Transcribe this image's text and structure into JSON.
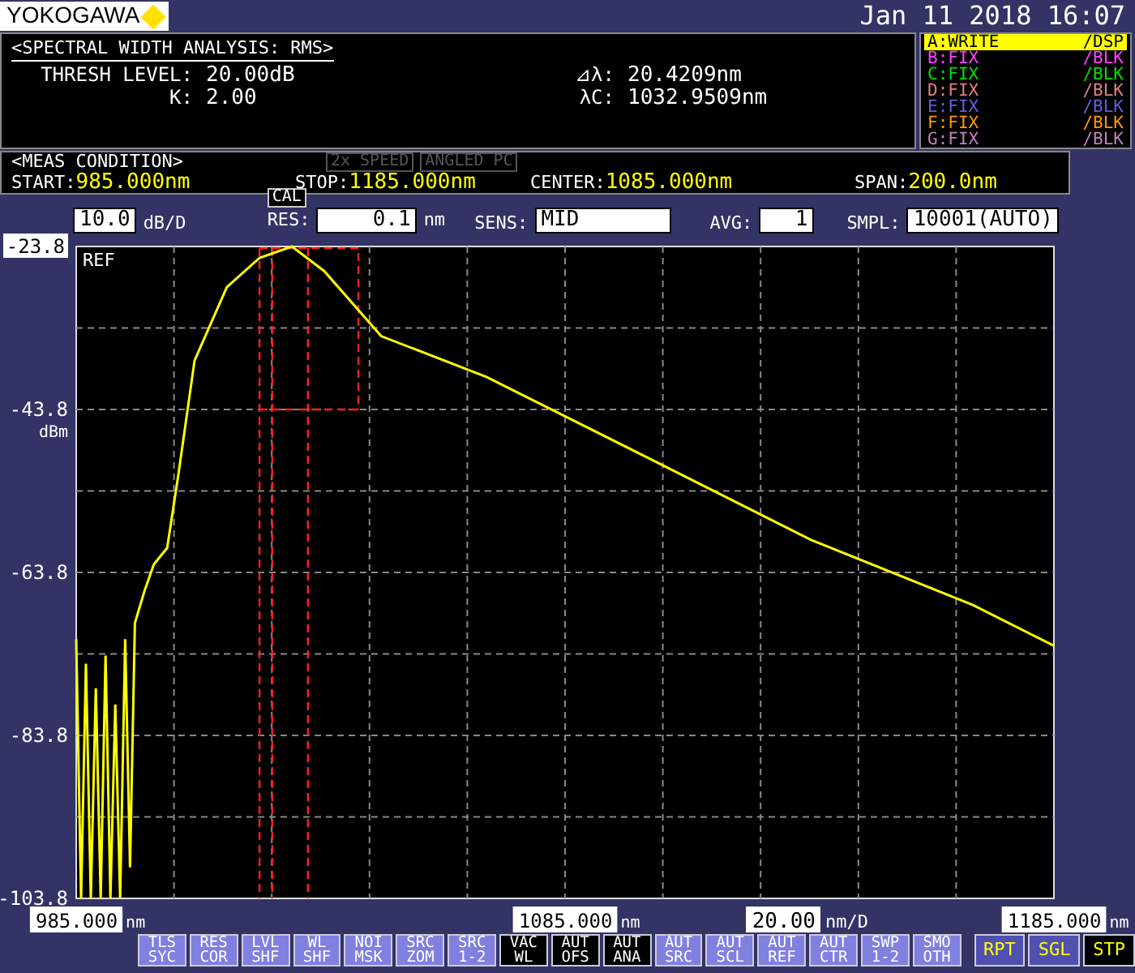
{
  "header": {
    "logo": "YOKOGAWA",
    "datetime": "Jan 11 2018 16:07"
  },
  "analysis": {
    "title": "<SPECTRAL WIDTH ANALYSIS: RMS>",
    "fields": [
      {
        "label": "THRESH LEVEL:",
        "value": "20.00dB"
      },
      {
        "label": "⊿λ:",
        "value": "20.4209nm"
      },
      {
        "label": "K:",
        "value": "2.00"
      },
      {
        "label": "λC:",
        "value": "1032.9509nm"
      }
    ]
  },
  "traces": [
    {
      "name": "A:WRITE",
      "mode": "/DSP",
      "color": "#ffff00",
      "selected": true
    },
    {
      "name": "B:FIX",
      "mode": "/BLK",
      "color": "#ff40ff",
      "selected": false
    },
    {
      "name": "C:FIX",
      "mode": "/BLK",
      "color": "#00e000",
      "selected": false
    },
    {
      "name": "D:FIX",
      "mode": "/BLK",
      "color": "#e08080",
      "selected": false
    },
    {
      "name": "E:FIX",
      "mode": "/BLK",
      "color": "#6060e0",
      "selected": false
    },
    {
      "name": "F:FIX",
      "mode": "/BLK",
      "color": "#ff9900",
      "selected": false
    },
    {
      "name": "G:FIX",
      "mode": "/BLK",
      "color": "#c080c0",
      "selected": false
    }
  ],
  "meas_condition": {
    "title": "<MEAS CONDITION>",
    "flags": [
      {
        "label": "2x SPEED",
        "on": false
      },
      {
        "label": "ANGLED PC",
        "on": false
      }
    ],
    "params": [
      {
        "label": "START:",
        "value": "985.000nm"
      },
      {
        "label": "STOP:",
        "value": "1185.000nm"
      },
      {
        "label": "CENTER:",
        "value": "1085.000nm"
      },
      {
        "label": "SPAN:",
        "value": "200.0nm"
      }
    ]
  },
  "settings": {
    "scale": "10.0",
    "scale_unit": "dB/D",
    "cal": "CAL",
    "res_label": "RES:",
    "res": "0.1",
    "res_unit": "nm",
    "sens_label": "SENS:",
    "sens": "MID",
    "avg_label": "AVG:",
    "avg": "1",
    "smpl_label": "SMPL:",
    "smpl": "10001(AUTO)"
  },
  "chart": {
    "ref_label": "REF",
    "chart_data": {
      "type": "line",
      "ylabel": "dBm",
      "xlim": [
        985,
        1185
      ],
      "ylim": [
        -103.8,
        -23.8
      ],
      "xticks": [
        {
          "value": 985,
          "label": "985.000"
        },
        {
          "value": 1085,
          "label": "1085.000"
        },
        {
          "value": 1185,
          "label": "1185.000"
        }
      ],
      "yticks": [
        {
          "value": -23.8,
          "label": "-23.8"
        },
        {
          "value": -43.8,
          "label": "-43.8"
        },
        {
          "value": -63.8,
          "label": "-63.8"
        },
        {
          "value": -83.8,
          "label": "-83.8"
        },
        {
          "value": -103.8,
          "label": "-103.8"
        }
      ],
      "x": [
        985,
        986,
        987,
        988,
        989,
        990,
        991,
        992,
        993,
        994,
        995,
        996,
        997,
        999,
        1000.9,
        1003.6,
        1005.9,
        1009.2,
        1015.8,
        1022.5,
        1029.1,
        1035.7,
        1047.4,
        1068.9,
        1102.1,
        1135.3,
        1168.4,
        1185
      ],
      "series": [
        {
          "color": "#ffff00",
          "values": [
            -72,
            -103.8,
            -75,
            -103.8,
            -78,
            -103.8,
            -74,
            -103.8,
            -80,
            -103.8,
            -72,
            -100,
            -70,
            -66,
            -62.8,
            -60.8,
            -51.8,
            -37.8,
            -28.8,
            -25.2,
            -23.8,
            -26.8,
            -34.8,
            -39.8,
            -49.8,
            -59.8,
            -67.8,
            -72.8
          ]
        }
      ],
      "grid": true,
      "ref_lines": [
        {
          "axis": "x",
          "value": 1022.5
        },
        {
          "axis": "x",
          "value": 1025.1
        },
        {
          "axis": "x",
          "value": 1032.4
        },
        {
          "axis": "y",
          "value": -43.8
        }
      ]
    }
  },
  "x_axis": {
    "tick_units": [
      "nm",
      "nm",
      "nm"
    ],
    "scale": "20.00",
    "scale_unit": "nm/D"
  },
  "softkeys": [
    {
      "lines": [
        "TLS",
        "SYC"
      ],
      "selected": false
    },
    {
      "lines": [
        "RES",
        "COR"
      ],
      "selected": false
    },
    {
      "lines": [
        "LVL",
        "SHF"
      ],
      "selected": false
    },
    {
      "lines": [
        "WL",
        "SHF"
      ],
      "selected": false
    },
    {
      "lines": [
        "NOI",
        "MSK"
      ],
      "selected": false
    },
    {
      "lines": [
        "SRC",
        "ZOM"
      ],
      "selected": false
    },
    {
      "lines": [
        "SRC",
        "1-2"
      ],
      "selected": false
    },
    {
      "lines": [
        "VAC",
        "WL"
      ],
      "selected": true
    },
    {
      "lines": [
        "AUT",
        "OFS"
      ],
      "selected": true
    },
    {
      "lines": [
        "AUT",
        "ANA"
      ],
      "selected": true
    },
    {
      "lines": [
        "AUT",
        "SRC"
      ],
      "selected": false
    },
    {
      "lines": [
        "AUT",
        "SCL"
      ],
      "selected": false
    },
    {
      "lines": [
        "AUT",
        "REF"
      ],
      "selected": false
    },
    {
      "lines": [
        "AUT",
        "CTR"
      ],
      "selected": false
    },
    {
      "lines": [
        "SWP",
        "1-2"
      ],
      "selected": false
    },
    {
      "lines": [
        "SMO",
        "OTH"
      ],
      "selected": false
    }
  ],
  "sweep_keys": [
    {
      "label": "RPT",
      "selected": false
    },
    {
      "label": "SGL",
      "selected": false
    },
    {
      "label": "STP",
      "selected": true
    }
  ]
}
